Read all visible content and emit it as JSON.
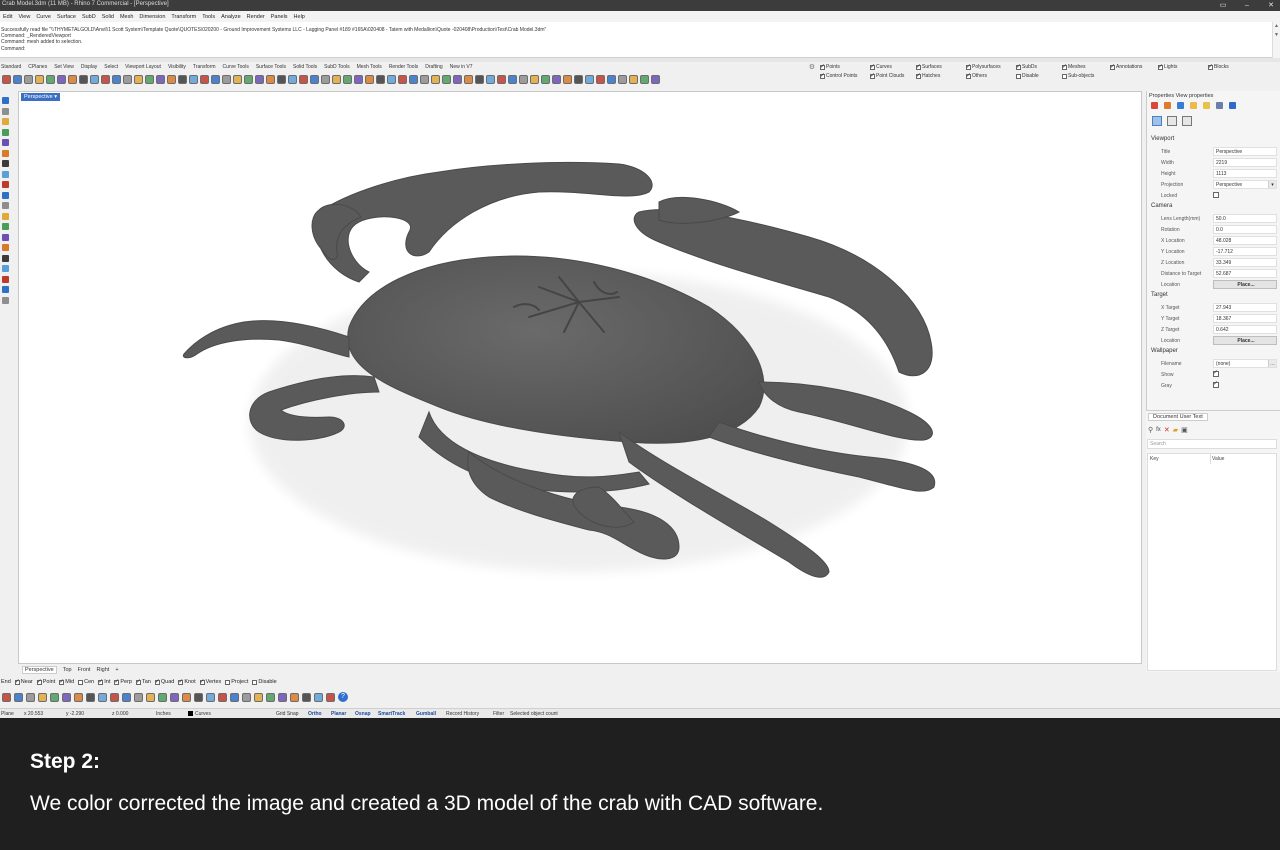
{
  "window": {
    "title": "Crab Model.3dm (11 MB) - Rhino 7 Commercial - [Perspective]",
    "controls": [
      "▭",
      "–",
      "✕"
    ]
  },
  "menu": [
    "Edit",
    "View",
    "Curve",
    "Surface",
    "SubD",
    "Solid",
    "Mesh",
    "Dimension",
    "Transform",
    "Tools",
    "Analyze",
    "Render",
    "Panels",
    "Help"
  ],
  "command_history": [
    "Successfully read file \"\\\\THYMETALGOLD\\Anvil\\1 Scott System\\Template Quote\\QUOTES\\020200 - Ground Improvement Systems LLC - Lagging Panel #189 #165A\\020408 - Tatem with Medallion\\Quote -020408\\Production\\Test\\Crab Model.3dm\"",
    "Command: _RenderedViewport",
    "Command: mesh added to selection.",
    "Command:"
  ],
  "tool_tabs": [
    "Standard",
    "CPlanes",
    "Set View",
    "Display",
    "Select",
    "Viewport Layout",
    "Visibility",
    "Transform",
    "Curve Tools",
    "Surface Tools",
    "Solid Tools",
    "SubD Tools",
    "Mesh Tools",
    "Render Tools",
    "Drafting",
    "New in V7"
  ],
  "filters": [
    {
      "label": "Points",
      "on": true
    },
    {
      "label": "Curves",
      "on": true
    },
    {
      "label": "Surfaces",
      "on": true
    },
    {
      "label": "Polysurfaces",
      "on": true
    },
    {
      "label": "SubDs",
      "on": true
    },
    {
      "label": "Meshes",
      "on": true
    },
    {
      "label": "Annotations",
      "on": true
    },
    {
      "label": "Lights",
      "on": true
    },
    {
      "label": "Blocks",
      "on": true
    },
    {
      "label": "Control Points",
      "on": true
    },
    {
      "label": "Point Clouds",
      "on": true
    },
    {
      "label": "Hatches",
      "on": true
    },
    {
      "label": "Others",
      "on": true
    },
    {
      "label": "Disable",
      "on": false
    },
    {
      "label": "Sub-objects",
      "on": false
    }
  ],
  "viewport": {
    "label": "Perspective ▾",
    "tabs": [
      "Perspective",
      "Top",
      "Front",
      "Right",
      "+"
    ]
  },
  "osnaps": [
    {
      "label": "End",
      "on": true
    },
    {
      "label": "Near",
      "on": true
    },
    {
      "label": "Point",
      "on": true
    },
    {
      "label": "Mid",
      "on": true
    },
    {
      "label": "Cen",
      "on": false
    },
    {
      "label": "Int",
      "on": true
    },
    {
      "label": "Perp",
      "on": true
    },
    {
      "label": "Tan",
      "on": true
    },
    {
      "label": "Quad",
      "on": true
    },
    {
      "label": "Knot",
      "on": true
    },
    {
      "label": "Vertex",
      "on": true
    },
    {
      "label": "Project",
      "on": false
    },
    {
      "label": "Disable",
      "on": false
    }
  ],
  "statusbar": {
    "cplane": "Plane",
    "x": "x 20.553",
    "y": "y -2.290",
    "z": "z 0.000",
    "units": "Inches",
    "layer": "Curves",
    "modes": [
      "Grid Snap",
      "Ortho",
      "Planar",
      "Osnap",
      "SmartTrack",
      "Gumball",
      "Record History",
      "Filter",
      "Selected object count"
    ]
  },
  "properties": {
    "header": "Properties  View properties",
    "viewport_title": "Viewport",
    "viewport": [
      {
        "key": "Title",
        "value": "Perspective"
      },
      {
        "key": "Width",
        "value": "2219"
      },
      {
        "key": "Height",
        "value": "1113"
      },
      {
        "key": "Projection",
        "value": "Perspective"
      },
      {
        "key": "Locked",
        "value": ""
      }
    ],
    "camera_title": "Camera",
    "camera": [
      {
        "key": "Lens Length(mm)",
        "value": "50.0"
      },
      {
        "key": "Rotation",
        "value": "0.0"
      },
      {
        "key": "X Location",
        "value": "48.028"
      },
      {
        "key": "Y Location",
        "value": "-17.712"
      },
      {
        "key": "Z Location",
        "value": "33.349"
      },
      {
        "key": "Distance to Target",
        "value": "52.687"
      },
      {
        "key": "Location",
        "value": "Place..."
      }
    ],
    "target_title": "Target",
    "target": [
      {
        "key": "X Target",
        "value": "27.943"
      },
      {
        "key": "Y Target",
        "value": "18.367"
      },
      {
        "key": "Z Target",
        "value": "0.642"
      },
      {
        "key": "Location",
        "value": "Place..."
      }
    ],
    "wallpaper_title": "Wallpaper",
    "wallpaper": [
      {
        "key": "Filename",
        "value": "(none)"
      },
      {
        "key": "Show",
        "value": ""
      },
      {
        "key": "Gray",
        "value": ""
      }
    ]
  },
  "document_user_text": {
    "tab": "Document User Text",
    "search_placeholder": "Search",
    "col_key": "Key",
    "col_value": "Value"
  },
  "caption": {
    "step": "Step 2:",
    "text": "We color corrected the image and created a 3D model of the crab with CAD software."
  },
  "colors": {
    "viewport_bg": "#ffffff",
    "model": "#5b5b5b",
    "caption_bg": "#1f1f1f",
    "accent": "#3a6fc4"
  }
}
